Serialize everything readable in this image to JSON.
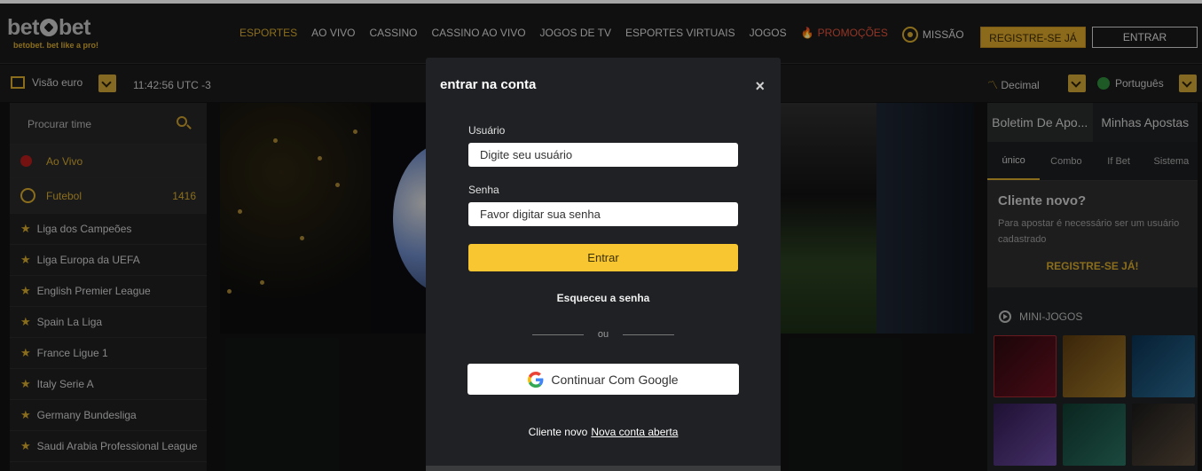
{
  "header": {
    "logo_text_a": "bet",
    "logo_text_b": "bet",
    "tagline": "betobet. bet like a pro!",
    "nav": [
      "ESPORTES",
      "AO VIVO",
      "CASSINO",
      "CASSINO AO VIVO",
      "JOGOS DE TV",
      "ESPORTES VIRTUAIS",
      "JOGOS"
    ],
    "promo_label": "PROMOÇÕES",
    "mission_label": "MISSÃO",
    "register_label": "REGISTRE-SE JÁ",
    "login_label": "ENTRAR"
  },
  "subbar": {
    "view_label": "Visão euro",
    "time": "11:42:56 UTC -3",
    "odds_label": "Decimal",
    "language_label": "Português"
  },
  "sidebar": {
    "search_placeholder": "Procurar time",
    "live_label": "Ao Vivo",
    "football_label": "Futebol",
    "football_count": "1416",
    "leagues": [
      "Liga dos Campeões",
      "Liga Europa da UEFA",
      "English Premier League",
      "Spain La Liga",
      "France Ligue 1",
      "Italy Serie A",
      "Germany Bundesliga",
      "Saudi Arabia Professional League"
    ]
  },
  "betslip": {
    "tab1": "Boletim De Apo...",
    "tab2": "Minhas Apostas",
    "subtabs": [
      "único",
      "Combo",
      "If Bet",
      "Sistema"
    ],
    "new_client_title": "Cliente novo?",
    "new_client_text": "Para apostar é necessário ser um usuário  cadastrado",
    "register_link": "REGISTRE-SE JÁ!",
    "mini_games_label": "MINI-JOGOS"
  },
  "modal": {
    "title": "entrar na conta",
    "close_icon": "×",
    "user_label": "Usuário",
    "user_placeholder": "Digite seu usuário",
    "password_label": "Senha",
    "password_placeholder": "Favor digitar sua senha",
    "enter_label": "Entrar",
    "forgot_label": "Esqueceu a senha",
    "or_label": "ou",
    "google_label": "Continuar Com Google",
    "new_client_prefix": "Cliente novo",
    "new_account_link": "Nova conta aberta"
  },
  "colors": {
    "accent": "#d4a82c",
    "button_yellow": "#f8c631",
    "modal_bg": "#1f2124"
  }
}
